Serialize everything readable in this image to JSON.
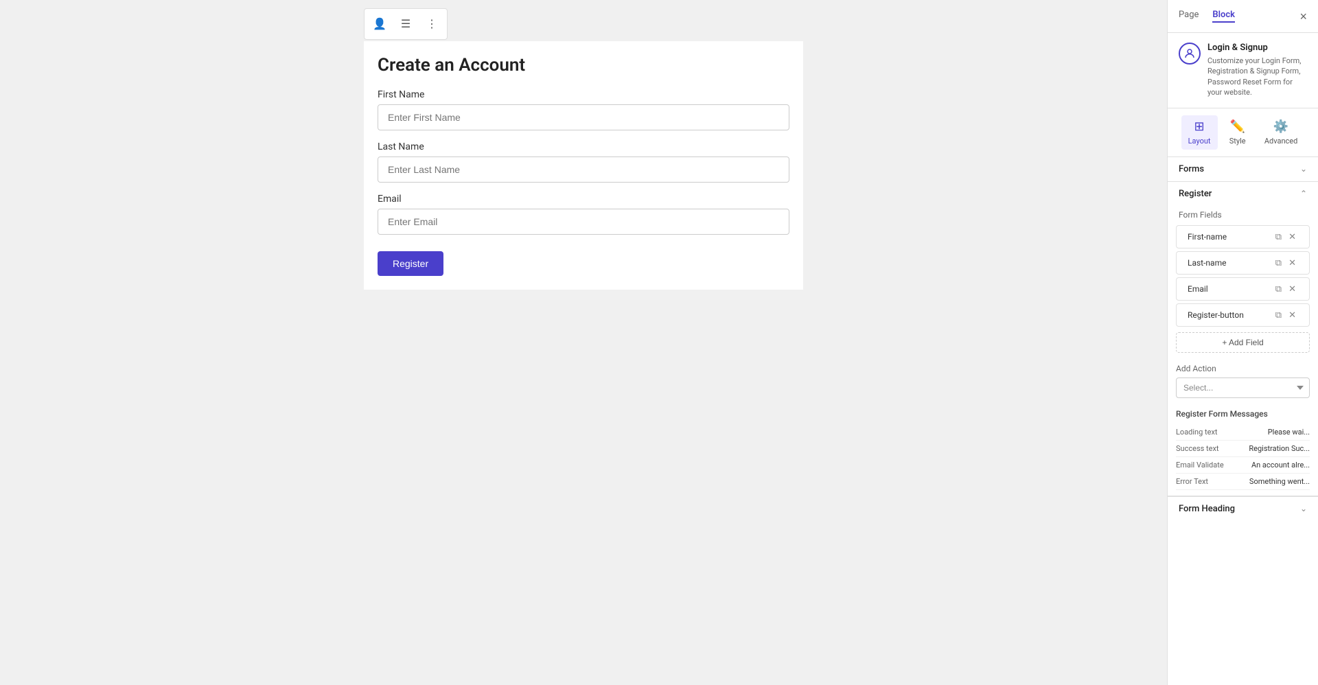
{
  "canvas": {
    "form_title": "Create an Account",
    "fields": [
      {
        "label": "First Name",
        "placeholder": "Enter First Name"
      },
      {
        "label": "Last Name",
        "placeholder": "Enter Last Name"
      },
      {
        "label": "Email",
        "placeholder": "Enter Email"
      }
    ],
    "register_button": "Register"
  },
  "toolbar_buttons": [
    {
      "icon": "👤",
      "label": "user-icon",
      "active": true
    },
    {
      "icon": "☰",
      "label": "menu-icon",
      "active": false
    },
    {
      "icon": "⋮",
      "label": "more-icon",
      "active": false
    }
  ],
  "panel": {
    "tabs": [
      {
        "label": "Page",
        "active": false
      },
      {
        "label": "Block",
        "active": true
      }
    ],
    "close_label": "×",
    "plugin": {
      "title": "Login & Signup",
      "description": "Customize your Login Form, Registration & Signup Form, Password Reset Form for your website."
    },
    "tab_icons": [
      {
        "label": "Layout",
        "active": true
      },
      {
        "label": "Style",
        "active": false
      },
      {
        "label": "Advanced",
        "active": false
      }
    ],
    "forms_section": {
      "label": "Forms",
      "collapsed": false
    },
    "register_section": {
      "label": "Register",
      "expanded": true
    },
    "form_fields_label": "Form Fields",
    "fields": [
      {
        "name": "First-name"
      },
      {
        "name": "Last-name"
      },
      {
        "name": "Email"
      },
      {
        "name": "Register-button"
      }
    ],
    "add_field_label": "+ Add Field",
    "add_action_label": "Add Action",
    "select_placeholder": "Select...",
    "messages_label": "Register Form Messages",
    "messages": [
      {
        "key": "Loading text",
        "value": "Please wai..."
      },
      {
        "key": "Success text",
        "value": "Registration Suc..."
      },
      {
        "key": "Email Validate",
        "value": "An account alre..."
      },
      {
        "key": "Error Text",
        "value": "Something went..."
      }
    ],
    "form_heading_label": "Form Heading"
  }
}
